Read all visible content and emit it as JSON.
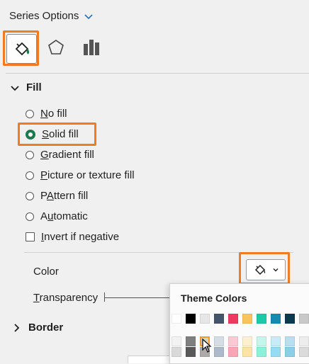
{
  "header": {
    "title": "Series Options"
  },
  "tabs": [
    "fill-line",
    "effects",
    "series-options"
  ],
  "fill_section": {
    "label": "Fill",
    "options": [
      {
        "label_u": "N",
        "label_rest": "o fill"
      },
      {
        "label_u": "S",
        "label_rest": "olid fill"
      },
      {
        "label_u": "G",
        "label_rest": "radient fill"
      },
      {
        "label_u": "P",
        "label_rest": "icture or texture fill"
      },
      {
        "label_u": "A",
        "label_rest": "ttern fill",
        "prefix": "P"
      },
      {
        "label_u": "u",
        "label_rest": "tomatic",
        "prefix": "A"
      }
    ],
    "invert": {
      "label_u": "I",
      "label_rest": "nvert if negative"
    },
    "color_label": "Color",
    "transparency_label_u": "T",
    "transparency_label_rest": "ransparency"
  },
  "border_section": {
    "label": "Border"
  },
  "popup": {
    "title": "Theme Colors",
    "row1": [
      "#ffffff",
      "#000000",
      "#e7e6e6",
      "#44546a",
      "#ee3a5f",
      "#f9c45b",
      "#1ec9a7",
      "#178ab0",
      "#0b3a4e",
      "#c9c9c9"
    ],
    "row2": [
      "#f2f2f2",
      "#7f7f7f",
      "#d0cece",
      "#d6dce4",
      "#fbc9d3",
      "#fdf0cf",
      "#c5f6eb",
      "#c7ecf7",
      "#b8dff0",
      "#ededed"
    ],
    "row3": [
      "#d9d9d9",
      "#595959",
      "#aeaaaa",
      "#adb9ca",
      "#f8a6b6",
      "#fce3a6",
      "#8df0d9",
      "#95dcf2",
      "#8ccde8",
      "#dbdbdb"
    ]
  }
}
